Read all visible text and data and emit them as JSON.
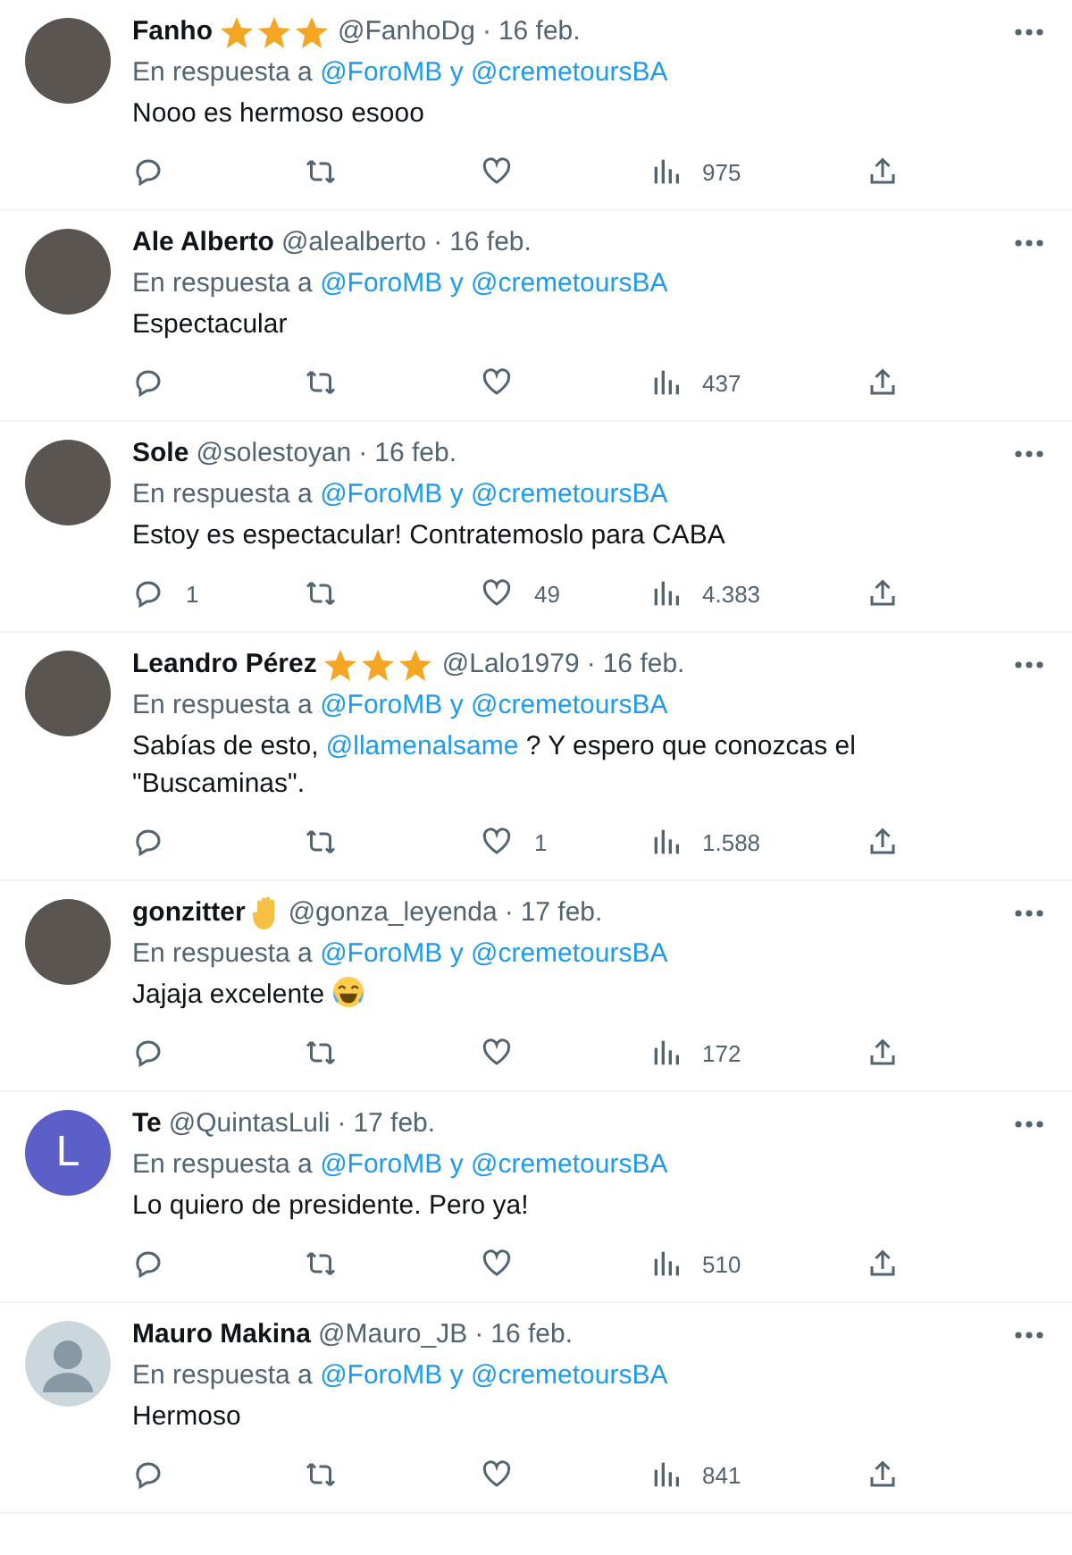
{
  "tweets": [
    {
      "avatar": {
        "kind": "photo"
      },
      "name": "Fanho",
      "badge": {
        "kind": "stars"
      },
      "handle": "@FanhoDg",
      "separator": "·",
      "date": "16 feb.",
      "reply_prefix": "En respuesta a",
      "reply_to": "@ForoMB y @cremetoursBA",
      "body": [
        {
          "kind": "plain",
          "text": "Nooo es hermoso esooo"
        }
      ],
      "views": "975"
    },
    {
      "avatar": {
        "kind": "photo"
      },
      "name": "Ale Alberto",
      "handle": "@alealberto",
      "separator": "·",
      "date": "16 feb.",
      "reply_prefix": "En respuesta a",
      "reply_to": "@ForoMB y @cremetoursBA",
      "body": [
        {
          "kind": "plain",
          "text": "Espectacular"
        }
      ],
      "views": "437"
    },
    {
      "avatar": {
        "kind": "photo"
      },
      "name": "Sole",
      "handle": "@solestoyan",
      "separator": "·",
      "date": "16 feb.",
      "reply_prefix": "En respuesta a",
      "reply_to": "@ForoMB y @cremetoursBA",
      "body": [
        {
          "kind": "plain",
          "text": "Estoy es espectacular! Contratemoslo para CABA"
        }
      ],
      "replies": "1",
      "likes": "49",
      "views": "4.383"
    },
    {
      "avatar": {
        "kind": "photo"
      },
      "name": "Leandro Pérez",
      "badge": {
        "kind": "stars"
      },
      "handle": "@Lalo1979",
      "separator": "·",
      "date": "16 feb.",
      "reply_prefix": "En respuesta a",
      "reply_to": "@ForoMB y @cremetoursBA",
      "body": [
        {
          "kind": "plain",
          "text": "Sabías de esto, "
        },
        {
          "kind": "mention",
          "text": "@llamenalsame"
        },
        {
          "kind": "plain",
          "text": " ? Y espero que conozcas el \"Buscaminas\"."
        }
      ],
      "likes": "1",
      "views": "1.588"
    },
    {
      "avatar": {
        "kind": "photo"
      },
      "name": "gonzitter",
      "badge": {
        "kind": "hand"
      },
      "handle": "@gonza_leyenda",
      "separator": "·",
      "date": "17 feb.",
      "reply_prefix": "En respuesta a",
      "reply_to": "@ForoMB y @cremetoursBA",
      "body": [
        {
          "kind": "plain",
          "text": "Jajaja excelente"
        },
        {
          "kind": "laugh-emoji"
        }
      ],
      "views": "172"
    },
    {
      "avatar": {
        "kind": "letter",
        "letter": "L"
      },
      "name": "Te",
      "handle": "@QuintasLuli",
      "separator": "·",
      "date": "17 feb.",
      "reply_prefix": "En respuesta a",
      "reply_to": "@ForoMB y @cremetoursBA",
      "body": [
        {
          "kind": "plain",
          "text": "Lo quiero de presidente. Pero ya!"
        }
      ],
      "views": "510"
    },
    {
      "avatar": {
        "kind": "default"
      },
      "name": "Mauro Makina",
      "handle": "@Mauro_JB",
      "separator": "·",
      "date": "16 feb.",
      "reply_prefix": "En respuesta a",
      "reply_to": "@ForoMB y @cremetoursBA",
      "body": [
        {
          "kind": "plain",
          "text": "Hermoso"
        }
      ],
      "views": "841"
    }
  ]
}
